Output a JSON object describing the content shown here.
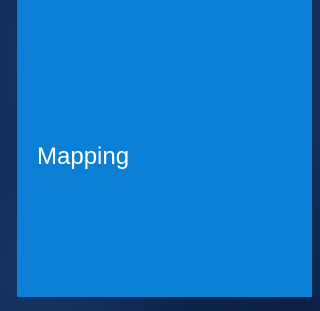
{
  "tile": {
    "label": "Mapping",
    "color": "#0a7fd4"
  },
  "background": {
    "color": "#0f2a55"
  }
}
